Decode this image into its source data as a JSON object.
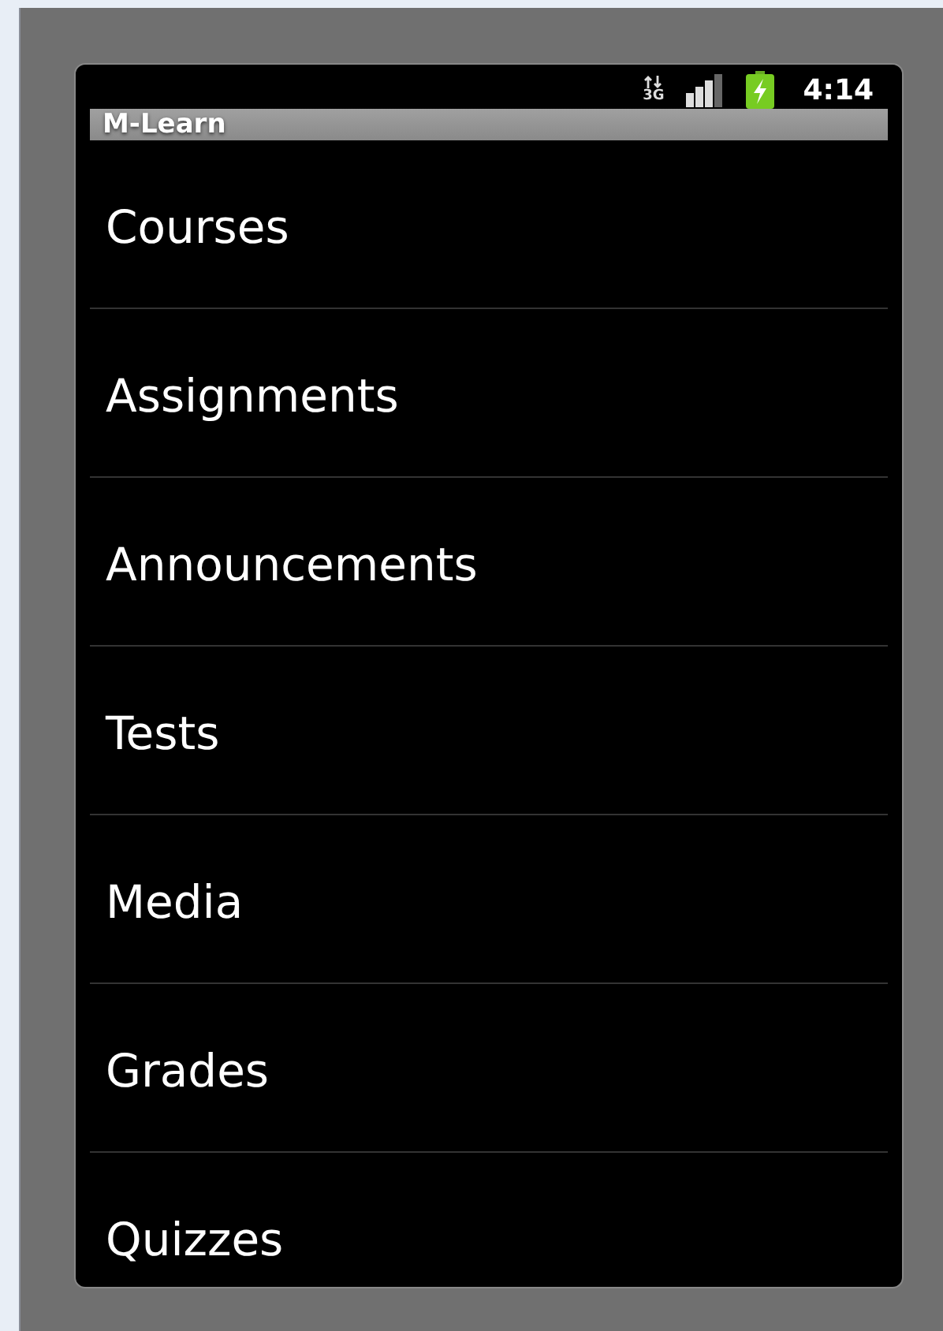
{
  "status_bar": {
    "network": "3G",
    "time": "4:14"
  },
  "title_bar": {
    "title": "M-Learn"
  },
  "menu": [
    {
      "label": "Courses"
    },
    {
      "label": "Assignments"
    },
    {
      "label": "Announcements"
    },
    {
      "label": "Tests"
    },
    {
      "label": "Media"
    },
    {
      "label": "Grades"
    },
    {
      "label": "Quizzes"
    }
  ]
}
